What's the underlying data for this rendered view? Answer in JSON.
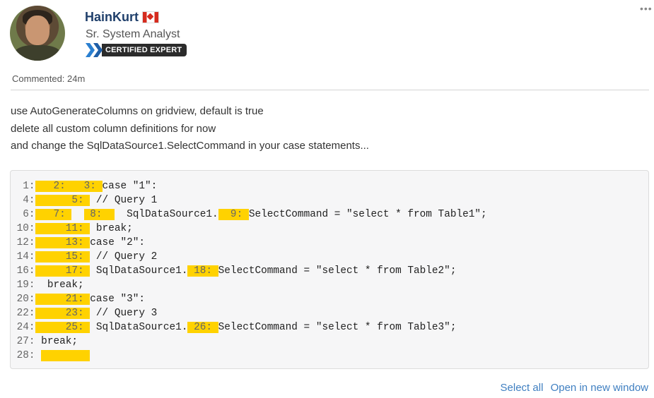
{
  "author": {
    "name": "HainKurt",
    "title": "Sr. System Analyst",
    "badge": "CERTIFIED EXPERT",
    "flag_icon": "canada-flag-icon"
  },
  "commented": "Commented: 24m",
  "body_lines": [
    "use AutoGenerateColumns on gridview, default is true",
    "delete all custom column definitions for now",
    "and change the SqlDataSource1.SelectCommand in your case statements..."
  ],
  "code": {
    "lines": [
      [
        {
          "t": "  1:",
          "c": "ln"
        },
        {
          "t": "   2:   3: ",
          "c": "hl"
        },
        {
          "t": "case \"1\":",
          "c": ""
        }
      ],
      [
        {
          "t": "  4:",
          "c": "ln"
        },
        {
          "t": "      5: ",
          "c": "hl"
        },
        {
          "t": " // Query 1",
          "c": ""
        }
      ],
      [
        {
          "t": "  6:",
          "c": "ln"
        },
        {
          "t": "   7: ",
          "c": "hl"
        },
        {
          "t": "  ",
          "c": ""
        },
        {
          "t": " 8:  ",
          "c": "hl"
        },
        {
          "t": "  SqlDataSource1.",
          "c": ""
        },
        {
          "t": "  9: ",
          "c": "hl"
        },
        {
          "t": "SelectCommand = \"select * from Table1\";",
          "c": ""
        }
      ],
      [
        {
          "t": " 10:",
          "c": "ln"
        },
        {
          "t": "     11: ",
          "c": "hl"
        },
        {
          "t": " break;",
          "c": ""
        }
      ],
      [
        {
          "t": " 12:",
          "c": "ln"
        },
        {
          "t": "     13: ",
          "c": "hl"
        },
        {
          "t": "case \"2\":",
          "c": ""
        }
      ],
      [
        {
          "t": " 14:",
          "c": "ln"
        },
        {
          "t": "     15: ",
          "c": "hl"
        },
        {
          "t": " // Query 2",
          "c": ""
        }
      ],
      [
        {
          "t": " 16:",
          "c": "ln"
        },
        {
          "t": "     17: ",
          "c": "hl"
        },
        {
          "t": " SqlDataSource1.",
          "c": ""
        },
        {
          "t": " 18: ",
          "c": "hl"
        },
        {
          "t": "SelectCommand = \"select * from Table2\";",
          "c": ""
        }
      ],
      [
        {
          "t": " 19:",
          "c": "ln"
        },
        {
          "t": "  break;",
          "c": ""
        }
      ],
      [
        {
          "t": " 20:",
          "c": "ln"
        },
        {
          "t": "     21: ",
          "c": "hl"
        },
        {
          "t": "case \"3\":",
          "c": ""
        }
      ],
      [
        {
          "t": " 22:",
          "c": "ln"
        },
        {
          "t": "     23: ",
          "c": "hl"
        },
        {
          "t": " // Query 3",
          "c": ""
        }
      ],
      [
        {
          "t": " 24:",
          "c": "ln"
        },
        {
          "t": "     25: ",
          "c": "hl"
        },
        {
          "t": " SqlDataSource1.",
          "c": ""
        },
        {
          "t": " 26: ",
          "c": "hl"
        },
        {
          "t": "SelectCommand = \"select * from Table3\";",
          "c": ""
        }
      ],
      [
        {
          "t": " 27:",
          "c": "ln"
        },
        {
          "t": " break;",
          "c": ""
        }
      ],
      [
        {
          "t": " 28:",
          "c": "ln"
        },
        {
          "t": " ",
          "c": ""
        },
        {
          "t": "        ",
          "c": "hl"
        }
      ]
    ]
  },
  "actions": {
    "select_all": "Select all",
    "open_new_window": "Open in new window"
  },
  "colors": {
    "name": "#1f3f6b",
    "link": "#3f7fc1",
    "highlight": "#ffd200",
    "badge_bg": "#2b2b2b",
    "expert_blue": "#2a7fd0"
  }
}
